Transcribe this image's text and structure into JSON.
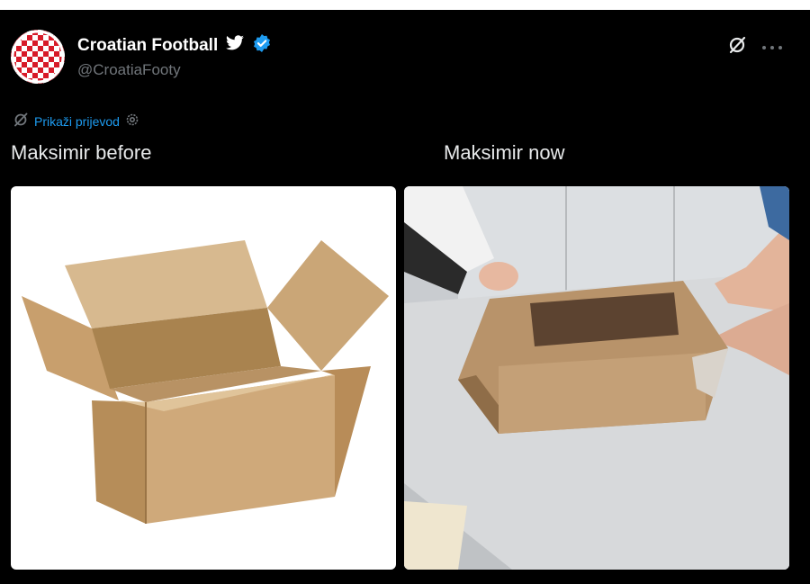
{
  "tweet": {
    "display_name": "Croatian Football",
    "handle": "@CroatiaFooty",
    "translate_label": "Prikaži prijevod",
    "captions": {
      "left": "Maksimir before",
      "right": "Maksimir now"
    },
    "images": [
      {
        "icon": "open-cardboard-box"
      },
      {
        "icon": "flattened-cardboard-box"
      }
    ]
  },
  "colors": {
    "background": "#000000",
    "text": "#e7e9ea",
    "muted": "#71767b",
    "link": "#1d9bf0",
    "verified": "#1d9bf0",
    "avatar_red": "#d71a28"
  }
}
